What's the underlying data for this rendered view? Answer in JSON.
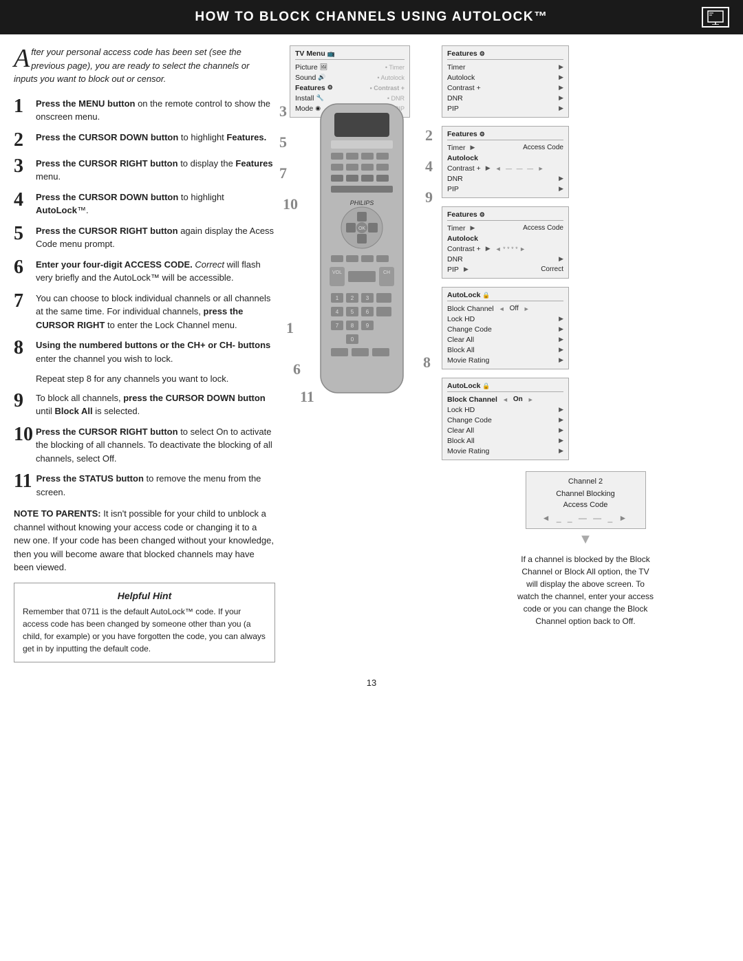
{
  "header": {
    "title": "HOW TO BLOCK CHANNELS USING AUTOLOCK™"
  },
  "intro": {
    "drop_cap": "A",
    "text": "fter your personal access code has been set (see the previous page), you are ready to select the channels or inputs you want to block out or censor."
  },
  "steps": [
    {
      "number": "1",
      "text": "Press the MENU button on the remote control to show the onscreen menu."
    },
    {
      "number": "2",
      "text": "Press the CURSOR DOWN button to highlight Features."
    },
    {
      "number": "3",
      "text": "Press the CURSOR RIGHT button to display the Features menu."
    },
    {
      "number": "4",
      "text": "Press the CURSOR DOWN button to highlight AutoLock™."
    },
    {
      "number": "5",
      "text": "Press the CURSOR RIGHT button again display the Acess Code menu prompt."
    },
    {
      "number": "6",
      "text": "Enter your four-digit ACCESS CODE. Correct will flash very briefly and the AutoLock™ will be accessible."
    },
    {
      "number": "7",
      "text": "You can choose to block individual channels or all channels at the same time. For individual channels, press the CURSOR RIGHT to enter the Lock Channel menu."
    },
    {
      "number": "8",
      "text": "Using the numbered buttons or the CH+ or CH- buttons enter the channel you wish to lock."
    },
    {
      "number": "9",
      "text": "To block all channels, press the CURSOR DOWN button until Block All is selected."
    },
    {
      "number": "10",
      "text": "Press the CURSOR RIGHT button to select On to activate the blocking of all channels. To deactivate the blocking of all channels, select Off."
    },
    {
      "number": "11",
      "text": "Press the STATUS button to remove the menu from the screen."
    }
  ],
  "repeat_note": "Repeat step 8 for any channels you want to lock.",
  "note_to_parents": {
    "label": "NOTE TO PARENTS:",
    "text": " It isn't possible for your child to unblock a channel without knowing your access code or changing it to a new one. If your code has been changed without your knowledge, then you will become aware that blocked channels may have been viewed."
  },
  "helpful_hint": {
    "title": "Helpful Hint",
    "text": "Remember that 0711 is the default AutoLock™ code. If your access code has been changed by someone other than you (a child, for example) or you have forgotten the code, you can always get in by inputting the default code."
  },
  "page_number": "13",
  "tv_menu_initial": {
    "title": "TV Menu",
    "items": [
      {
        "label": "Picture",
        "icon": true
      },
      {
        "label": "Sound",
        "icon": true
      },
      {
        "label": "Features",
        "icon": true,
        "highlighted": true
      },
      {
        "label": "Install",
        "icon": true
      },
      {
        "label": "Mode",
        "icon": true
      }
    ],
    "sub_items": [
      "• Timer",
      "• Autolock",
      "• Contrast +",
      "• DNR",
      "• PIP"
    ]
  },
  "screens": [
    {
      "id": "features_1",
      "title": "Features",
      "steps_label": "3\n5\n7\n10",
      "rows": [
        {
          "label": "Timer",
          "arrow": true
        },
        {
          "label": "Autolock",
          "arrow": true
        },
        {
          "label": "Contrast +",
          "arrow": true
        },
        {
          "label": "DNR",
          "arrow": true
        },
        {
          "label": "PIP",
          "arrow": true
        }
      ]
    },
    {
      "id": "features_autolock",
      "title": "Features",
      "rows": [
        {
          "label": "Timer",
          "arrow": true,
          "right": "Access Code"
        },
        {
          "label": "Autolock",
          "bold": true
        },
        {
          "label": "Contrast +",
          "arrow": true,
          "dots": true
        },
        {
          "label": "DNR",
          "arrow": true
        },
        {
          "label": "PIP",
          "arrow": true
        }
      ],
      "steps_badge": "2\n4\n9"
    },
    {
      "id": "features_code",
      "title": "Features",
      "rows": [
        {
          "label": "Timer",
          "arrow": true,
          "right": "Access Code"
        },
        {
          "label": "Autolock",
          "bold": true
        },
        {
          "label": "Contrast +",
          "arrow": true,
          "dots": "* * * *"
        },
        {
          "label": "DNR",
          "arrow": true
        },
        {
          "label": "PIP",
          "arrow": true,
          "right": "Correct"
        }
      ],
      "steps_badge": "6"
    },
    {
      "id": "autolock_off",
      "title": "AutoLock",
      "rows": [
        {
          "label": "Block Channel",
          "arrow": true,
          "value": "Off",
          "arrow_right": true
        },
        {
          "label": "Lock HD",
          "arrow": true
        },
        {
          "label": "Change Code",
          "arrow": true
        },
        {
          "label": "Clear All",
          "arrow": true
        },
        {
          "label": "Block All",
          "arrow": true
        },
        {
          "label": "Movie Rating",
          "arrow": true
        }
      ],
      "steps_badge": "8"
    },
    {
      "id": "autolock_on",
      "title": "AutoLock",
      "rows": [
        {
          "label": "Block Channel",
          "bold": true,
          "arrow": true,
          "value": "On",
          "arrow_right": true
        },
        {
          "label": "Lock HD",
          "arrow": true
        },
        {
          "label": "Change Code",
          "arrow": true
        },
        {
          "label": "Clear All",
          "arrow": true
        },
        {
          "label": "Block All",
          "arrow": true
        },
        {
          "label": "Movie Rating",
          "arrow": true
        }
      ],
      "steps_badge": "11"
    },
    {
      "id": "channel_blocking",
      "channel": "Channel 2",
      "sub1": "Channel Blocking",
      "sub2": "Access Code",
      "dots": "◄  _ _ - - _  ►"
    }
  ],
  "caption": {
    "text": "If a channel is blocked by the Block Channel or Block All option, the TV will display the above screen. To watch the channel, enter your access code or you can change the Block Channel option back to Off."
  },
  "remote_numbers": [
    "3",
    "5",
    "7",
    "10",
    "2",
    "4",
    "9",
    "1",
    "6",
    "8",
    "11"
  ]
}
